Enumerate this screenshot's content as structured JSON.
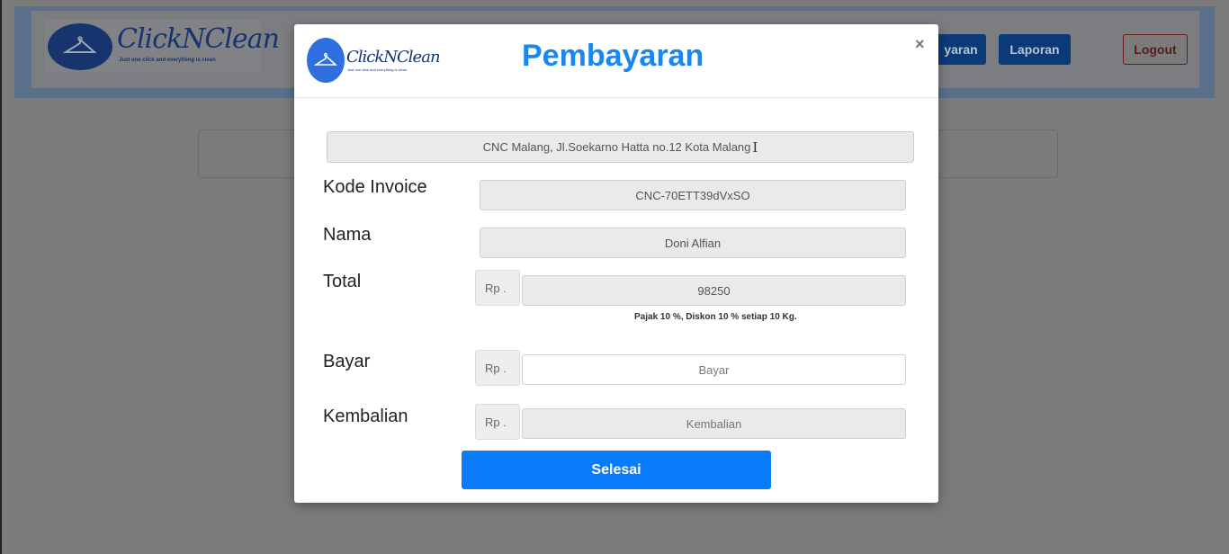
{
  "background": {
    "brand": "ClickNClean",
    "tagline": "Just one click and everything is clean",
    "nav": {
      "pembayaran_label": "yaran",
      "laporan_label": "Laporan",
      "logout_label": "Logout"
    }
  },
  "modal": {
    "brand": "ClickNClean",
    "tagline": "Just one click and everything is clean",
    "title": "Pembayaran",
    "close_symbol": "×",
    "address": "CNC Malang, Jl.Soekarno Hatta no.12 Kota Malang",
    "fields": {
      "kode_invoice": {
        "label": "Kode Invoice",
        "value": "CNC-70ETT39dVxSO"
      },
      "nama": {
        "label": "Nama",
        "value": "Doni Alfian"
      },
      "total": {
        "label": "Total",
        "prefix": "Rp .",
        "value": "98250"
      },
      "bayar": {
        "label": "Bayar",
        "prefix": "Rp .",
        "placeholder": "Bayar"
      },
      "kembalian": {
        "label": "Kembalian",
        "prefix": "Rp .",
        "placeholder": "Kembalian"
      }
    },
    "note": "Pajak 10 %, Diskon 10 % setiap 10 Kg.",
    "submit_label": "Selesai"
  },
  "colors": {
    "accent": "#1a86f0",
    "button": "#0a7cfa",
    "overlay": "#7b7b7b"
  }
}
